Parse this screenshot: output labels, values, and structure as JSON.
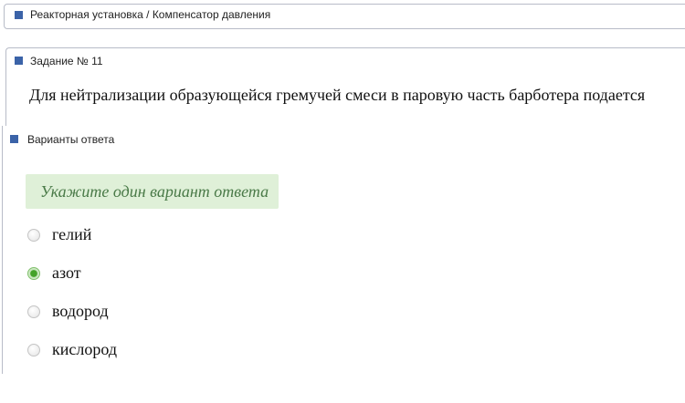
{
  "breadcrumb": {
    "text": "Реакторная установка / Компенсатор давления"
  },
  "task": {
    "title": "Задание № 11",
    "question": "Для нейтрализации образующейся гремучей смеси в паровую часть барботера подается"
  },
  "answers": {
    "title": "Варианты ответа",
    "hint": "Укажите один вариант ответа",
    "options": [
      {
        "label": "гелий",
        "selected": false
      },
      {
        "label": "азот",
        "selected": true
      },
      {
        "label": "водород",
        "selected": false
      },
      {
        "label": "кислород",
        "selected": false
      }
    ]
  },
  "colors": {
    "section_marker": "#3b63a8",
    "hint_background": "#dff0d8",
    "hint_text": "#4a7a48",
    "radio_selected": "#44a329"
  }
}
